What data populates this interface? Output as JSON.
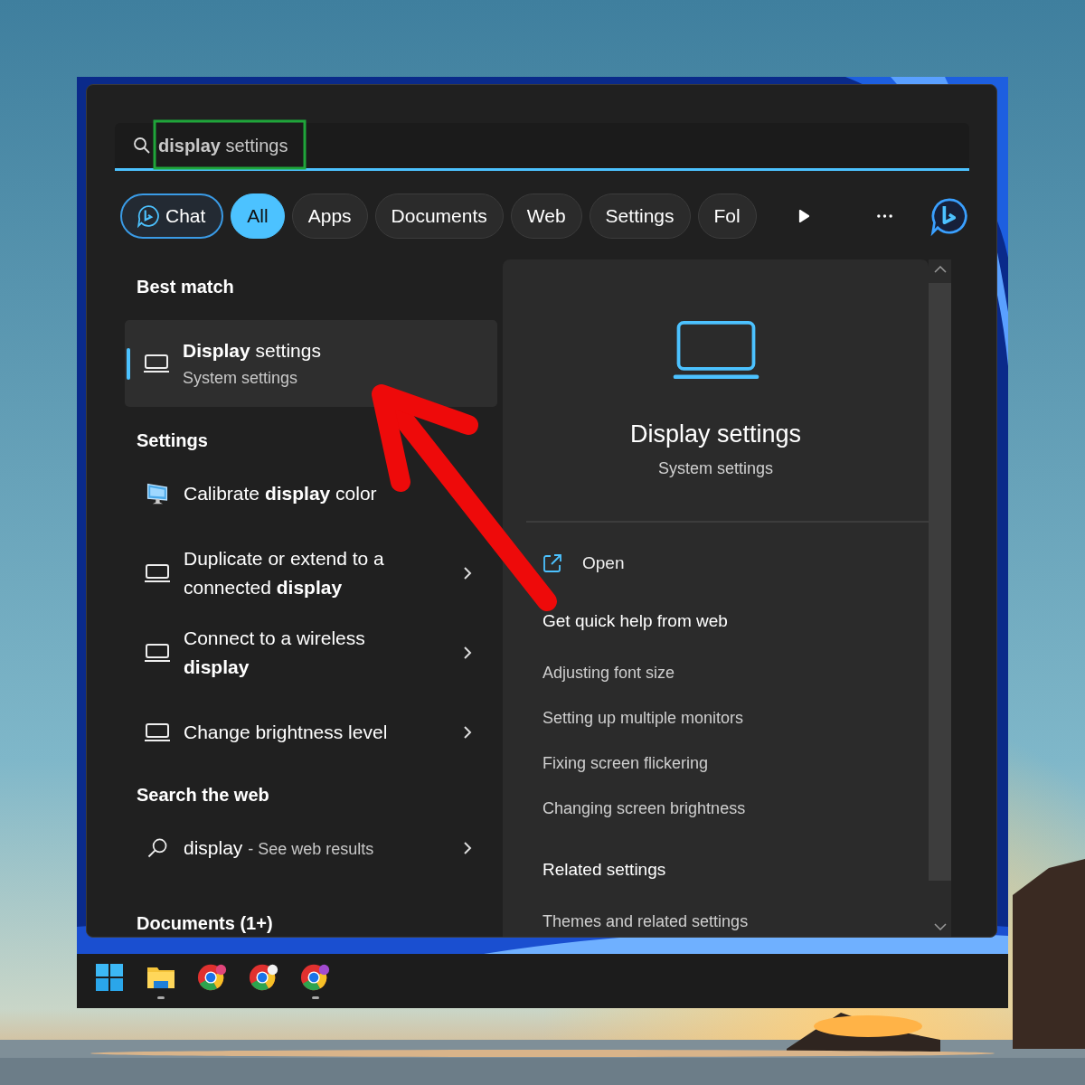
{
  "search": {
    "value": "**display** settings"
  },
  "filters": [
    {
      "kind": "chat",
      "label": "Chat",
      "selected": false
    },
    {
      "kind": "text",
      "label": "All",
      "selected": true
    },
    {
      "kind": "text",
      "label": "Apps",
      "selected": false
    },
    {
      "kind": "text",
      "label": "Documents",
      "selected": false
    },
    {
      "kind": "text",
      "label": "Web",
      "selected": false
    },
    {
      "kind": "text",
      "label": "Settings",
      "selected": false
    },
    {
      "kind": "text",
      "label": "Fol",
      "selected": false
    }
  ],
  "best_match": {
    "heading": "Best match",
    "title": "**Display** settings",
    "subtitle": "System settings",
    "selected": true
  },
  "settings": {
    "heading": "Settings",
    "items": [
      {
        "kind": "monitor",
        "title": "Calibrate **display** color"
      },
      {
        "kind": "laptop",
        "title": "Duplicate or extend to a connected **display**",
        "chevron": true
      },
      {
        "kind": "laptop",
        "title": "Connect to a wireless **display**",
        "chevron": true
      },
      {
        "kind": "laptop",
        "title": "Change brightness level",
        "chevron": true
      }
    ]
  },
  "web": {
    "heading": "Search the web",
    "items": [
      {
        "query": "display",
        "suffix": "- See web results",
        "chevron": true
      }
    ]
  },
  "documents": {
    "heading": "Documents (1+)"
  },
  "preview": {
    "title": "Display settings",
    "subtitle": "System settings",
    "open_label": "Open",
    "help_heading": "Get quick help from web",
    "help_links": [
      "Adjusting font size",
      "Setting up multiple monitors",
      "Fixing screen flickering",
      "Changing screen brightness"
    ],
    "related_heading": "Related settings",
    "related_links": [
      "Themes and related settings"
    ]
  },
  "taskbar": {
    "apps": [
      {
        "kind": "start",
        "running": false
      },
      {
        "kind": "folder",
        "running": true
      },
      {
        "kind": "browser",
        "running": false,
        "color": "#e0457b"
      },
      {
        "kind": "browser",
        "running": false,
        "color": "#f2f2f2"
      },
      {
        "kind": "browser",
        "running": true,
        "color": "#a24bd0"
      }
    ]
  }
}
